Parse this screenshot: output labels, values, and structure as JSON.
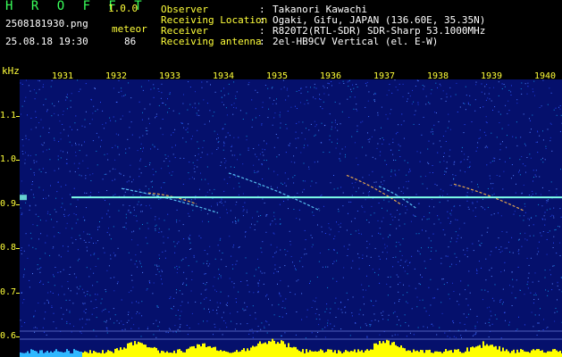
{
  "header": {
    "app_title": "H R O F F T",
    "app_version": "1.0.0",
    "filename": "2508181930.png",
    "meteor_label": "meteor",
    "datetime": "25.08.18 19:30",
    "meteor_count": "86"
  },
  "info": [
    {
      "label": "Observer",
      "value": "Takanori Kawachi"
    },
    {
      "label": "Receiving Location",
      "value": "Ogaki, Gifu, JAPAN (136.60E, 35.35N)"
    },
    {
      "label": "Receiver",
      "value": "R820T2(RTL-SDR) SDR-Sharp 53.1000MHz"
    },
    {
      "label": "Receiving antenna",
      "value": "2el-HB9CV Vertical (el. E-W)"
    }
  ],
  "info_colon": ":",
  "axes": {
    "y_unit": "kHz",
    "y_ticks": [
      "1.1",
      "1.0",
      "0.9",
      "0.8",
      "0.7",
      "0.6"
    ],
    "x_ticks": [
      "1931",
      "1932",
      "1933",
      "1934",
      "1935",
      "1936",
      "1937",
      "1938",
      "1939",
      "1940"
    ]
  },
  "colors": {
    "background": "#000000",
    "plot_background": "#05106c",
    "label_yellow": "#ffff3a",
    "label_green": "#39ff5a",
    "carrier_line": "#7dffe8",
    "bottom_bar": "#ffff00"
  },
  "spectrogram": {
    "carrier_khz": 0.915,
    "trails": [
      {
        "x_start": 1932.1,
        "x_end": 1933.9,
        "khz_start": 0.935,
        "khz_end": 0.88
      },
      {
        "x_start": 1932.6,
        "x_end": 1933.5,
        "khz_start": 0.925,
        "khz_end": 0.9
      },
      {
        "x_start": 1934.1,
        "x_end": 1935.8,
        "khz_start": 0.97,
        "khz_end": 0.885
      },
      {
        "x_start": 1936.3,
        "x_end": 1937.3,
        "khz_start": 0.965,
        "khz_end": 0.9
      },
      {
        "x_start": 1936.9,
        "x_end": 1937.6,
        "khz_start": 0.94,
        "khz_end": 0.89
      },
      {
        "x_start": 1938.3,
        "x_end": 1939.6,
        "khz_start": 0.945,
        "khz_end": 0.885
      }
    ],
    "meteor_count_value": 86
  }
}
